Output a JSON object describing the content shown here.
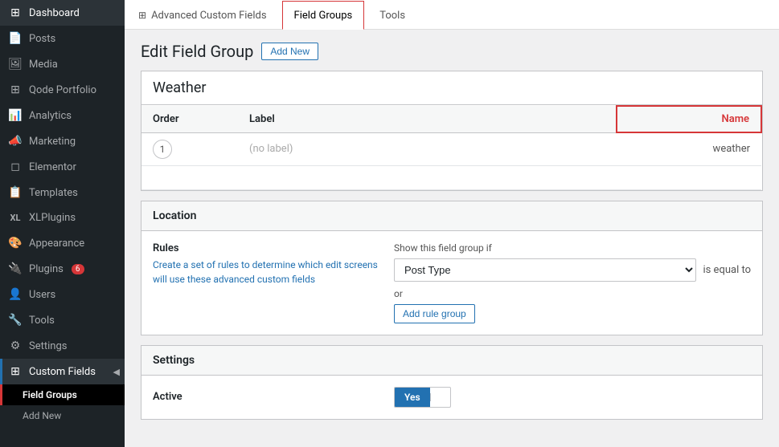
{
  "sidebar": {
    "items": [
      {
        "id": "dashboard",
        "label": "Dashboard",
        "icon": "⊞",
        "active": false
      },
      {
        "id": "posts",
        "label": "Posts",
        "icon": "📄",
        "active": false
      },
      {
        "id": "media",
        "label": "Media",
        "icon": "🖼",
        "active": false
      },
      {
        "id": "qode-portfolio",
        "label": "Qode Portfolio",
        "icon": "⊞",
        "active": false
      },
      {
        "id": "analytics",
        "label": "Analytics",
        "icon": "📊",
        "active": false
      },
      {
        "id": "marketing",
        "label": "Marketing",
        "icon": "📣",
        "active": false
      },
      {
        "id": "elementor",
        "label": "Elementor",
        "icon": "◻",
        "active": false
      },
      {
        "id": "templates",
        "label": "Templates",
        "icon": "📋",
        "active": false
      },
      {
        "id": "xlplugins",
        "label": "XLPlugins",
        "icon": "XL",
        "active": false
      },
      {
        "id": "appearance",
        "label": "Appearance",
        "icon": "🎨",
        "active": false
      },
      {
        "id": "plugins",
        "label": "Plugins",
        "icon": "🔌",
        "badge": "6",
        "active": false
      },
      {
        "id": "users",
        "label": "Users",
        "icon": "👤",
        "active": false
      },
      {
        "id": "tools",
        "label": "Tools",
        "icon": "🔧",
        "active": false
      },
      {
        "id": "settings",
        "label": "Settings",
        "icon": "⚙",
        "active": false
      },
      {
        "id": "custom-fields",
        "label": "Custom Fields",
        "icon": "⊞",
        "active": true
      }
    ],
    "subitems": [
      {
        "id": "field-groups",
        "label": "Field Groups",
        "active": true
      },
      {
        "id": "add-new",
        "label": "Add New",
        "active": false
      }
    ]
  },
  "topnav": {
    "items": [
      {
        "id": "acf",
        "label": "Advanced Custom Fields",
        "icon": "⊞",
        "active": false
      },
      {
        "id": "field-groups",
        "label": "Field Groups",
        "active": true
      },
      {
        "id": "tools",
        "label": "Tools",
        "active": false
      }
    ]
  },
  "page": {
    "title": "Edit Field Group",
    "add_new_label": "Add New",
    "field_group_name": "Weather"
  },
  "table": {
    "columns": [
      "Order",
      "Label",
      "Name"
    ],
    "rows": [
      {
        "order": "1",
        "label": "(no label)",
        "name": "weather"
      }
    ]
  },
  "location": {
    "section_title": "Location",
    "rules_label": "Rules",
    "rules_desc": "Create a set of rules to determine which edit screens will use these advanced custom fields",
    "show_label": "Show this field group if",
    "post_type_value": "Post Type",
    "is_equal_to": "is equal to",
    "or_text": "or",
    "add_rule_label": "Add rule group"
  },
  "settings": {
    "section_title": "Settings",
    "active_label": "Active",
    "toggle_yes": "Yes",
    "toggle_no": ""
  }
}
